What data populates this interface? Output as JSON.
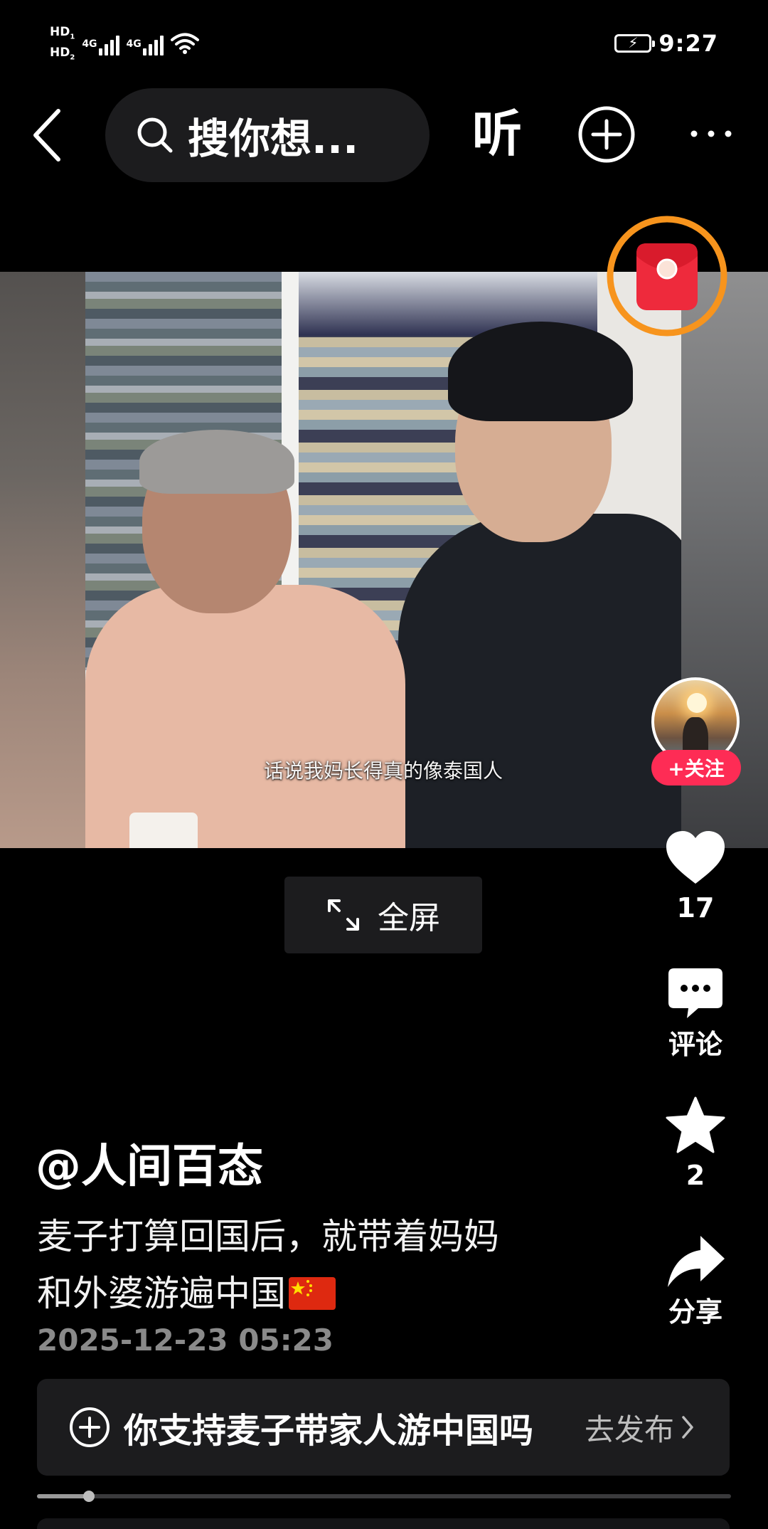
{
  "status_bar": {
    "hd1": "HD",
    "hd1_sub": "1",
    "hd2": "HD",
    "hd2_sub": "2",
    "net1": "4G",
    "net2": "4G",
    "time": "9:27"
  },
  "nav": {
    "search_placeholder": "搜你想...",
    "listen_label": "听"
  },
  "video": {
    "subtitle": "话说我妈长得真的像泰国人"
  },
  "fullscreen": {
    "label": "全屏"
  },
  "actions": {
    "follow_label": "+关注",
    "like_count": "17",
    "comment_label": "评论",
    "collect_count": "2",
    "share_label": "分享"
  },
  "post": {
    "author": "@人间百态",
    "desc_line1": "麦子打算回国后，就带着妈妈",
    "desc_line2": "和外婆游遍中国",
    "timestamp": "2025-12-23 05:23"
  },
  "topic": {
    "text": "你支持麦子带家人游中国吗",
    "action": "去发布"
  },
  "progress": {
    "fraction": 0.075
  },
  "colors": {
    "background": "#000000",
    "surface": "#1c1c1e",
    "accent_red": "#fe2c55",
    "ring_orange": "#f7941d",
    "muted_text": "#8a8a8a"
  },
  "icons": {
    "back": "chevron-left-icon",
    "search": "search-icon",
    "add": "plus-circle-icon",
    "more": "more-dots-icon",
    "red_packet": "red-envelope-icon",
    "like": "heart-icon",
    "comment": "comment-bubble-icon",
    "collect": "star-icon",
    "share": "share-arrow-icon",
    "fullscreen": "expand-icon",
    "flag": "china-flag-icon"
  }
}
